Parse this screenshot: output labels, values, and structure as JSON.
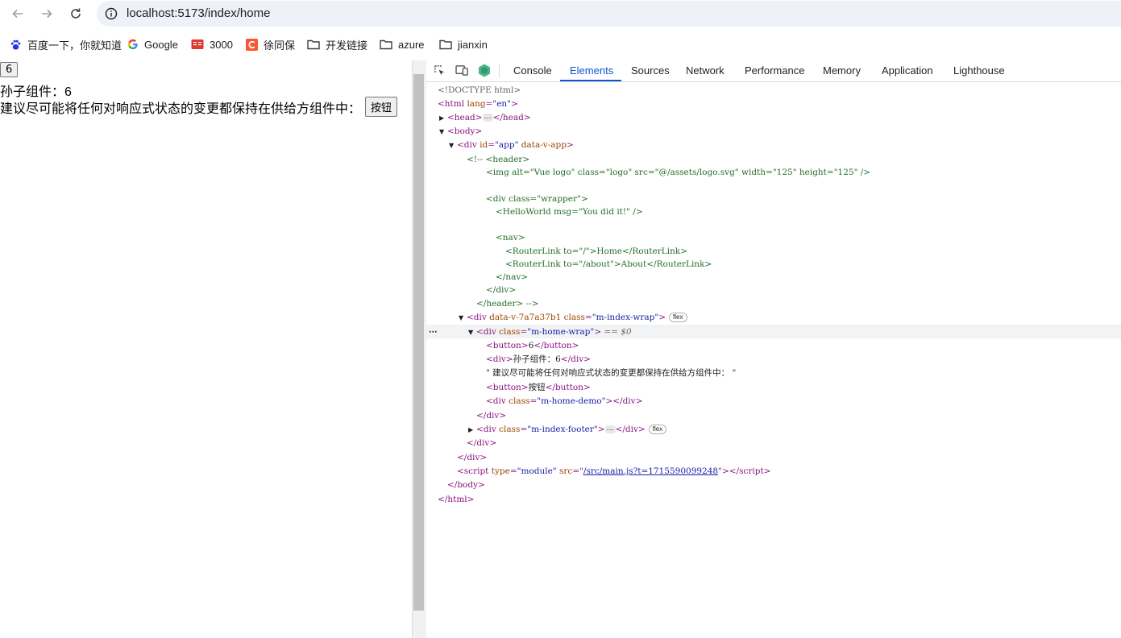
{
  "browser": {
    "url": "localhost:5173/index/home",
    "bookmarks": [
      {
        "label": "百度一下，你就知道",
        "icon": "baidu-paw-icon"
      },
      {
        "label": "Google",
        "icon": "google-g-icon"
      },
      {
        "label": "3000",
        "icon": "red-book-icon"
      },
      {
        "label": "徐同保",
        "icon": "csdn-c-icon"
      },
      {
        "label": "开发链接",
        "icon": "folder-icon"
      },
      {
        "label": "azure",
        "icon": "folder-icon"
      },
      {
        "label": "jianxin",
        "icon": "folder-icon"
      }
    ]
  },
  "page": {
    "counter_button": "6",
    "grandchild_text": "孙子组件：6",
    "suggestion_text": "建议尽可能将任何对响应式状态的变更都保持在供给方组件中：",
    "action_button": "按钮"
  },
  "devtools": {
    "tabs": [
      "Console",
      "Elements",
      "Sources",
      "Network",
      "Performance",
      "Memory",
      "Application",
      "Lighthouse"
    ],
    "active_tab": "Elements",
    "selected_marker": "== $0",
    "tree": {
      "doctype": "<!DOCTYPE html>",
      "html_open": "<html ",
      "html_lang_attr": "lang",
      "html_lang_val": "\"en\"",
      "head": "<head>",
      "head_close": "</head>",
      "body_open": "<body>",
      "app_open": "<div ",
      "app_id_attr": "id",
      "app_id_val": "\"app\"",
      "app_data_attr": "data-v-app",
      "comment_lines": [
        "<!-- <header>",
        "<img alt=\"Vue logo\" class=\"logo\" src=\"@/assets/logo.svg\" width=\"125\" height=\"125\" />",
        "<div class=\"wrapper\">",
        "<HelloWorld msg=\"You did it!\" />",
        "<nav>",
        "<RouterLink to=\"/\">Home</RouterLink>",
        "<RouterLink to=\"/about\">About</RouterLink>",
        "</nav>",
        "</div>",
        "</header> -->"
      ],
      "index_wrap_scope": "data-v-7a7a37b1",
      "index_wrap_class": "\"m-index-wrap\"",
      "home_wrap_class": "\"m-home-wrap\"",
      "button_line": "6",
      "div_text": "孙子组件：6",
      "text_node": "\" 建议尽可能将任何对响应式状态的变更都保持在供给方组件中： \"",
      "button2_text": "按钮",
      "home_demo_class": "\"m-home-demo\"",
      "footer_class": "\"m-index-footer\"",
      "script_type_val": "\"module\"",
      "script_src": "/src/main.js?t=1715590099248",
      "flex_badge": "flex"
    }
  }
}
